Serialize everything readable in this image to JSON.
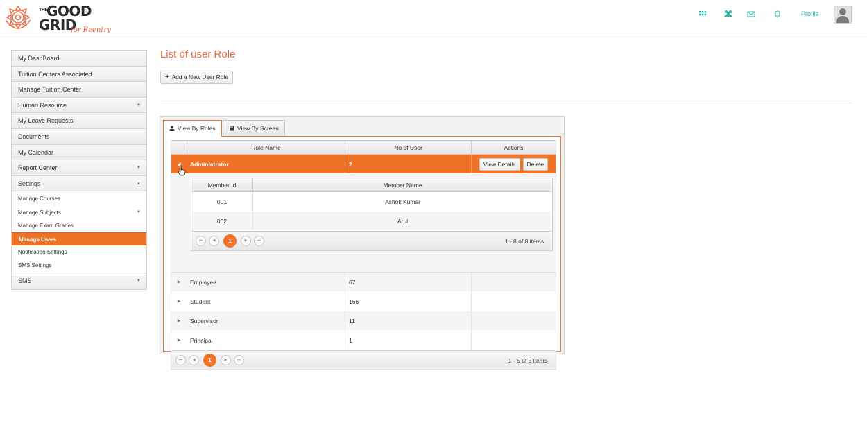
{
  "header": {
    "logo": {
      "the": "THE",
      "good": "GOOD",
      "grid": "GRID",
      "tagline": "for Reentry"
    },
    "icons": [
      "grid-icon",
      "users-icon",
      "mail-icon",
      "bell-icon"
    ],
    "profile_label": "Profile",
    "accent": "#2ab4a4"
  },
  "sidebar": {
    "items": [
      {
        "label": "My DashBoard"
      },
      {
        "label": "Tuition Centers Associated"
      },
      {
        "label": "Manage Tuition Center"
      },
      {
        "label": "Human Resource",
        "caret": "▼"
      },
      {
        "label": "My Leave Requests"
      },
      {
        "label": "Documents"
      },
      {
        "label": "My Calendar"
      },
      {
        "label": "Report Center",
        "caret": "▼"
      },
      {
        "label": "Settings",
        "caret": "▲"
      }
    ],
    "settings_sub": [
      {
        "label": "Manage Courses"
      },
      {
        "label": "Manage Subjects",
        "caret": "▼"
      },
      {
        "label": "Manage Exam Grades"
      },
      {
        "label": "Manage Users",
        "active": true
      },
      {
        "label": "Notification Settings"
      },
      {
        "label": "SMS Settings"
      }
    ],
    "last_item": {
      "label": "SMS",
      "caret": "▼"
    },
    "active_color": "#f07225"
  },
  "main": {
    "title": "List of user Role",
    "add_button": "Add a New User Role",
    "tabs": [
      {
        "label": "View By Roles",
        "active": true
      },
      {
        "label": "View By Screen",
        "active": false
      }
    ],
    "grid": {
      "columns": [
        "Role Name",
        "No of User",
        "Actions"
      ],
      "rows": [
        {
          "role": "Administrator",
          "count": "2",
          "expanded": true,
          "selected": true
        },
        {
          "role": "Employee",
          "count": "67"
        },
        {
          "role": "Student",
          "count": "166"
        },
        {
          "role": "Supervisor",
          "count": "11"
        },
        {
          "role": "Principal",
          "count": "1"
        }
      ],
      "actions": {
        "view_details": "View Details",
        "delete": "Delete"
      },
      "pager": {
        "page": "1",
        "info": "1 - 5 of 5 items"
      }
    },
    "detail": {
      "columns": [
        "Member Id",
        "Member Name"
      ],
      "rows": [
        {
          "id": "001",
          "name": "Ashok Kumar"
        },
        {
          "id": "002",
          "name": "Arul"
        }
      ],
      "pager": {
        "page": "1",
        "info": "1 - 8 of 8 items"
      }
    }
  }
}
